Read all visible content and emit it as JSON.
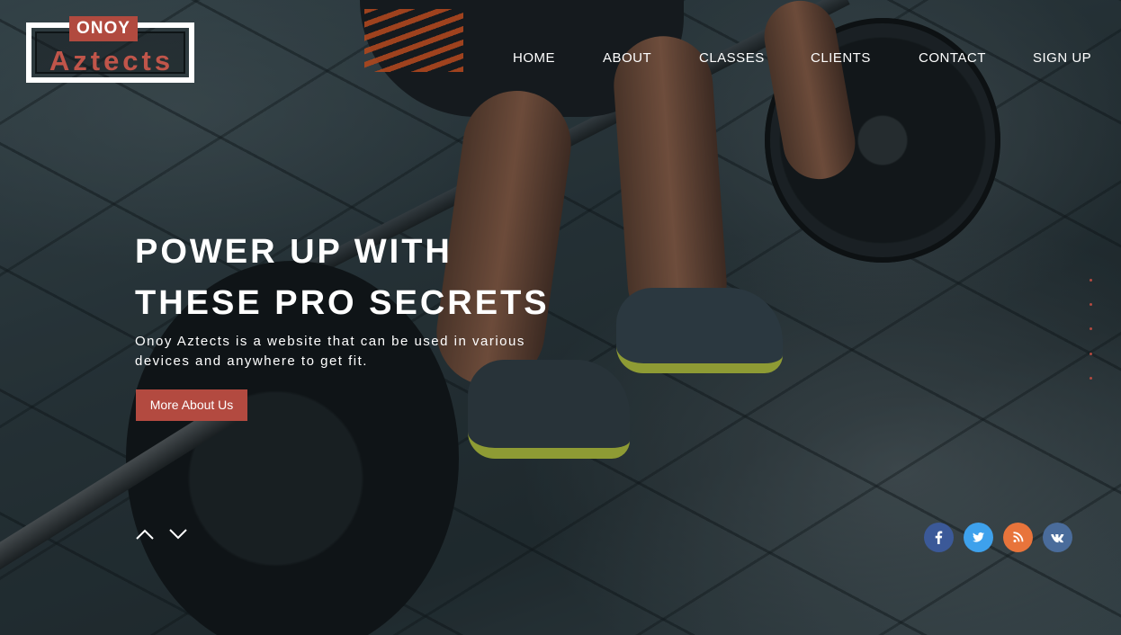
{
  "logo": {
    "top": "ONOY",
    "main": "Aztects"
  },
  "nav": {
    "items": [
      "HOME",
      "ABOUT",
      "CLASSES",
      "CLIENTS",
      "CONTACT",
      "SIGN UP"
    ]
  },
  "hero": {
    "headline_line1": "POWER UP WITH",
    "headline_line2": "THESE PRO SECRETS",
    "subtitle_line1": "Onoy Aztects is a website that can be used in various",
    "subtitle_line2": "devices and anywhere to get fit.",
    "cta_label": "More About Us"
  },
  "slider": {
    "prev_icon": "chevron-up-icon",
    "next_icon": "chevron-down-icon"
  },
  "social": [
    {
      "name": "facebook-icon",
      "glyph": "f",
      "color": "#3b5998"
    },
    {
      "name": "twitter-icon",
      "glyph": "t",
      "color": "#3ea1ec"
    },
    {
      "name": "rss-icon",
      "glyph": "rss",
      "color": "#e8743b"
    },
    {
      "name": "vk-icon",
      "glyph": "vk",
      "color": "#4a6c9b"
    }
  ],
  "colors": {
    "accent": "#b34a40",
    "logo_text": "#c0554a",
    "text": "#ffffff"
  }
}
